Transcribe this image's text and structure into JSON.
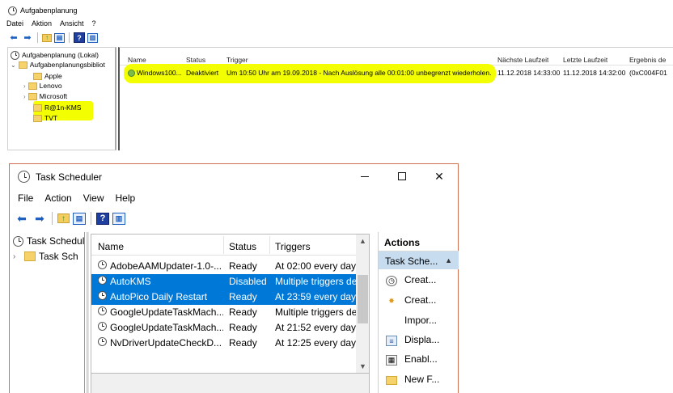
{
  "top_window": {
    "title": "Aufgabenplanung",
    "menu": [
      "Datei",
      "Aktion",
      "Ansicht",
      "?"
    ],
    "tree": {
      "root": "Aufgabenplanung (Lokal)",
      "library": "Aufgabenplanungsbibliot",
      "folders": [
        "Apple",
        "Lenovo",
        "Microsoft",
        "R@1n-KMS",
        "TVT"
      ]
    },
    "columns": [
      "Name",
      "Status",
      "Trigger",
      "Nächste Laufzeit",
      "Letzte Laufzeit",
      "Ergebnis de"
    ],
    "row": {
      "name": "Windows100...",
      "status": "Deaktiviert",
      "trigger": "Um 10:50 Uhr am 19.09.2018 - Nach Auslösung alle 00:01:00 unbegrenzt wiederholen.",
      "next_run": "11.12.2018 14:33:00",
      "last_run": "11.12.2018 14:32:00",
      "result": "(0xC004F01"
    },
    "highlight_color": "#f3ff00"
  },
  "bottom_window": {
    "title": "Task Scheduler",
    "controls": {
      "minimize": "—",
      "maximize": "☐",
      "close": "✕"
    },
    "menu": [
      "File",
      "Action",
      "View",
      "Help"
    ],
    "tree": {
      "root": "Task Schedule",
      "library": "Task Sch"
    },
    "columns": [
      "Name",
      "Status",
      "Triggers"
    ],
    "rows": [
      {
        "name": "AdobeAAMUpdater-1.0-...",
        "status": "Ready",
        "trigger": "At 02:00 every day",
        "selected": false
      },
      {
        "name": "AutoKMS",
        "status": "Disabled",
        "trigger": "Multiple triggers de",
        "selected": true
      },
      {
        "name": "AutoPico Daily Restart",
        "status": "Ready",
        "trigger": "At 23:59 every day",
        "selected": true
      },
      {
        "name": "GoogleUpdateTaskMach...",
        "status": "Ready",
        "trigger": "Multiple triggers de",
        "selected": false
      },
      {
        "name": "GoogleUpdateTaskMach...",
        "status": "Ready",
        "trigger": "At 21:52 every day",
        "selected": false
      },
      {
        "name": "NvDriverUpdateCheckD...",
        "status": "Ready",
        "trigger": "At 12:25 every day",
        "selected": false
      }
    ],
    "actions": {
      "header": "Actions",
      "section": "Task Sche...",
      "items": [
        {
          "label": "Creat...",
          "icon": "create-basic-task-icon"
        },
        {
          "label": "Creat...",
          "icon": "create-task-icon"
        },
        {
          "label": "Impor...",
          "icon": ""
        },
        {
          "label": "Displa...",
          "icon": "display-running-tasks-icon"
        },
        {
          "label": "Enabl...",
          "icon": "enable-history-icon"
        },
        {
          "label": "New F...",
          "icon": "new-folder-icon"
        }
      ]
    },
    "selection_color": "#0078d7"
  }
}
